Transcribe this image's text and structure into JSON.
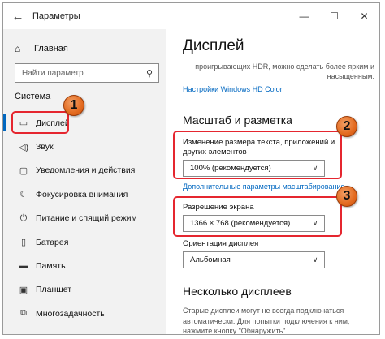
{
  "window": {
    "title": "Параметры",
    "back_icon": "back-arrow-icon",
    "controls": {
      "minimize": "—",
      "maximize": "☐",
      "close": "✕"
    }
  },
  "sidebar": {
    "home": {
      "label": "Главная",
      "icon": "home-icon"
    },
    "search": {
      "placeholder": "Найти параметр",
      "icon": "search-icon"
    },
    "section_title": "Система",
    "items": [
      {
        "label": "Дисплей",
        "icon": "display-icon",
        "active": true
      },
      {
        "label": "Звук",
        "icon": "sound-icon"
      },
      {
        "label": "Уведомления и действия",
        "icon": "notifications-icon"
      },
      {
        "label": "Фокусировка внимания",
        "icon": "focus-assist-icon"
      },
      {
        "label": "Питание и спящий режим",
        "icon": "power-icon"
      },
      {
        "label": "Батарея",
        "icon": "battery-icon"
      },
      {
        "label": "Память",
        "icon": "storage-icon"
      },
      {
        "label": "Планшет",
        "icon": "tablet-icon"
      },
      {
        "label": "Многозадачность",
        "icon": "multitasking-icon"
      }
    ]
  },
  "main": {
    "title": "Дисплей",
    "hdr_desc": "проигрывающих HDR, можно сделать более ярким и насыщенным.",
    "hdr_link": "Настройки Windows HD Color",
    "scale_section": "Масштаб и разметка",
    "scale_label": "Изменение размера текста, приложений и других элементов",
    "scale_value": "100% (рекомендуется)",
    "scale_link": "Дополнительные параметры масштабирования",
    "resolution_label": "Разрешение экрана",
    "resolution_value": "1366 × 768 (рекомендуется)",
    "orientation_label": "Ориентация дисплея",
    "orientation_value": "Альбомная",
    "multi_section": "Несколько дисплеев",
    "multi_desc": "Старые дисплеи могут не всегда подключаться автоматически. Для попытки подключения к ним, нажмите кнопку \"Обнаружить\"."
  },
  "annotations": {
    "badge1": "1",
    "badge2": "2",
    "badge3": "3",
    "highlight_color": "#e5262f",
    "badge_color": "#e36a1f"
  }
}
